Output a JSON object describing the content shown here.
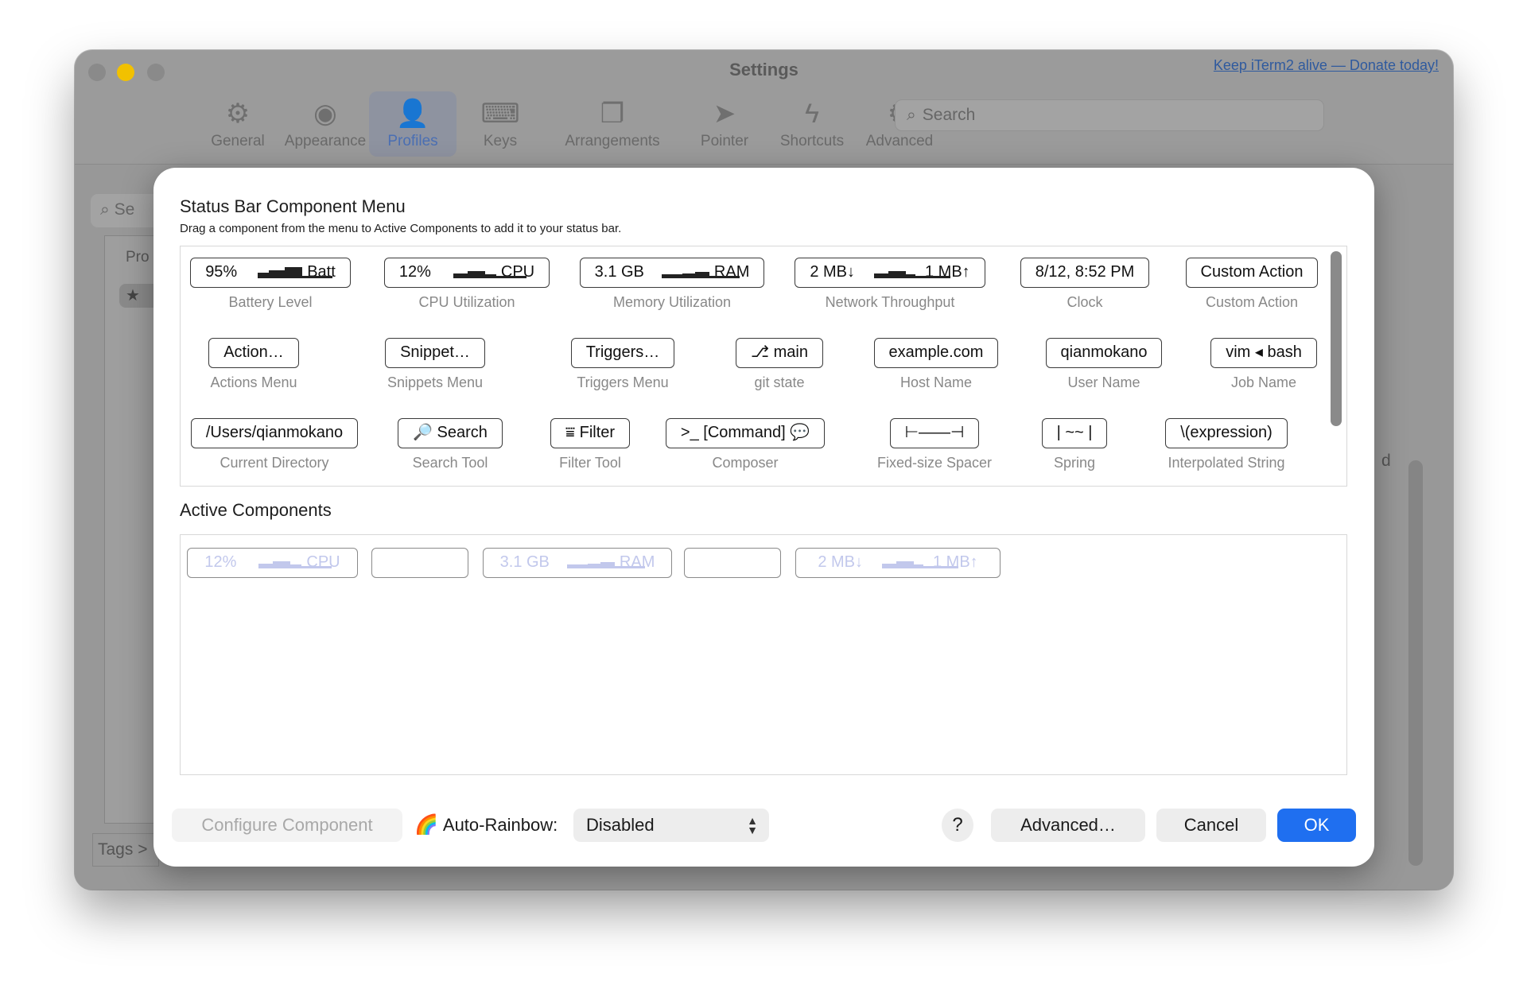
{
  "window": {
    "title": "Settings",
    "donate_link": "Keep iTerm2 alive — Donate today!",
    "toolbar": [
      {
        "label": "General",
        "icon": "gear-icon",
        "glyph": "⚙"
      },
      {
        "label": "Appearance",
        "icon": "eye-icon",
        "glyph": "◉"
      },
      {
        "label": "Profiles",
        "icon": "person-icon",
        "glyph": "👤"
      },
      {
        "label": "Keys",
        "icon": "keyboard-icon",
        "glyph": "⌨"
      },
      {
        "label": "Arrangements",
        "icon": "windows-icon",
        "glyph": "❐"
      },
      {
        "label": "Pointer",
        "icon": "pointer-icon",
        "glyph": "➤"
      },
      {
        "label": "Shortcuts",
        "icon": "bolt-icon",
        "glyph": "ϟ"
      },
      {
        "label": "Advanced",
        "icon": "gears-icon",
        "glyph": "⚙"
      }
    ],
    "search_placeholder": "Search",
    "bg_search_placeholder": "Se",
    "bg_list_header": "Pro",
    "bg_tags": "Tags >",
    "bg_text_d": "d"
  },
  "sheet": {
    "title": "Status Bar Component Menu",
    "subtitle": "Drag a component from the menu to Active Components to add it to your status bar.",
    "menu_components": [
      {
        "chip_pre": "95%",
        "chip_post": "Batt",
        "spark": true,
        "caption": "Battery Level"
      },
      {
        "chip_pre": "12%",
        "chip_post": "CPU",
        "spark": true,
        "caption": "CPU Utilization"
      },
      {
        "chip_pre": "3.1 GB",
        "chip_post": "RAM",
        "spark": true,
        "caption": "Memory Utilization"
      },
      {
        "chip_pre": "2 MB↓",
        "chip_post": "1 MB↑",
        "spark": true,
        "caption": "Network Throughput"
      },
      {
        "chip": "8/12, 8:52 PM",
        "caption": "Clock"
      },
      {
        "chip": "Custom Action",
        "caption": "Custom Action"
      },
      {
        "chip": "Action…",
        "caption": "Actions Menu"
      },
      {
        "chip": "Snippet…",
        "caption": "Snippets Menu"
      },
      {
        "chip": "Triggers…",
        "caption": "Triggers Menu"
      },
      {
        "chip": "⎇ main",
        "caption": "git state"
      },
      {
        "chip": "example.com",
        "caption": "Host Name"
      },
      {
        "chip": "qianmokano",
        "caption": "User Name"
      },
      {
        "chip": "vim ◂ bash",
        "caption": "Job Name"
      },
      {
        "chip": "/Users/qianmokano",
        "caption": "Current Directory"
      },
      {
        "chip": "🔎 Search",
        "caption": "Search Tool"
      },
      {
        "chip": "⩸ Filter",
        "caption": "Filter Tool"
      },
      {
        "chip": ">_ [Command] 💬",
        "caption": "Composer"
      },
      {
        "chip": "⊢——⊣",
        "caption": "Fixed-size Spacer"
      },
      {
        "chip": "| ~~ |",
        "caption": "Spring"
      },
      {
        "chip": "\\(expression)",
        "caption": "Interpolated String"
      }
    ],
    "active_title": "Active Components",
    "active_components": [
      {
        "chip_pre": "12%",
        "chip_post": "CPU",
        "spark": true
      },
      {
        "chip": ""
      },
      {
        "chip_pre": "3.1 GB",
        "chip_post": "RAM",
        "spark": true
      },
      {
        "chip": ""
      },
      {
        "chip_pre": "2 MB↓",
        "chip_post": "1 MB↑",
        "spark": true
      }
    ],
    "footer": {
      "configure_label": "Configure Component",
      "rainbow_emoji": "🌈",
      "rainbow_label": "Auto-Rainbow:",
      "rainbow_value": "Disabled",
      "help_label": "?",
      "advanced_label": "Advanced…",
      "cancel_label": "Cancel",
      "ok_label": "OK"
    }
  },
  "colors": {
    "accent": "#1f6ff0",
    "caption": "#888888",
    "inactive_chip_text": "#c2c8ec"
  }
}
